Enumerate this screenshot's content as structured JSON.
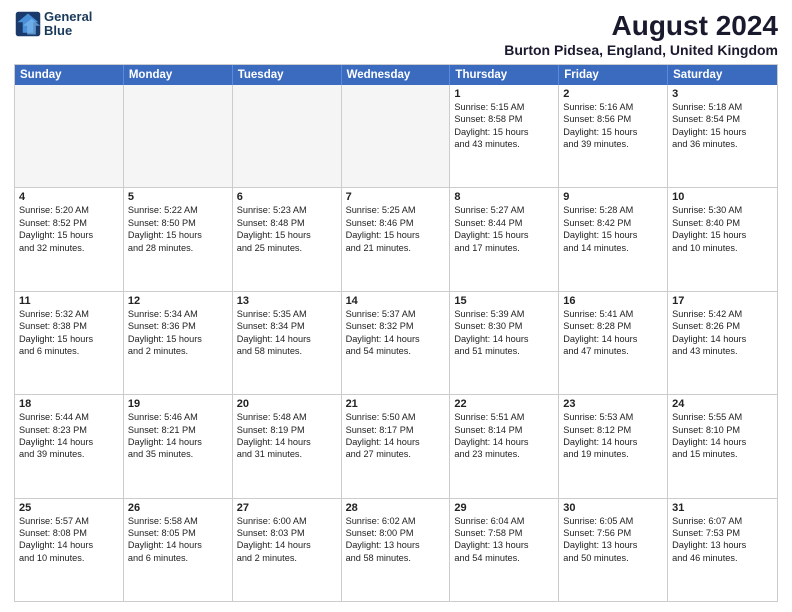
{
  "header": {
    "logo_line1": "General",
    "logo_line2": "Blue",
    "main_title": "August 2024",
    "subtitle": "Burton Pidsea, England, United Kingdom"
  },
  "calendar": {
    "headers": [
      "Sunday",
      "Monday",
      "Tuesday",
      "Wednesday",
      "Thursday",
      "Friday",
      "Saturday"
    ],
    "weeks": [
      [
        {
          "day": "",
          "info": ""
        },
        {
          "day": "",
          "info": ""
        },
        {
          "day": "",
          "info": ""
        },
        {
          "day": "",
          "info": ""
        },
        {
          "day": "1",
          "info": "Sunrise: 5:15 AM\nSunset: 8:58 PM\nDaylight: 15 hours\nand 43 minutes."
        },
        {
          "day": "2",
          "info": "Sunrise: 5:16 AM\nSunset: 8:56 PM\nDaylight: 15 hours\nand 39 minutes."
        },
        {
          "day": "3",
          "info": "Sunrise: 5:18 AM\nSunset: 8:54 PM\nDaylight: 15 hours\nand 36 minutes."
        }
      ],
      [
        {
          "day": "4",
          "info": "Sunrise: 5:20 AM\nSunset: 8:52 PM\nDaylight: 15 hours\nand 32 minutes."
        },
        {
          "day": "5",
          "info": "Sunrise: 5:22 AM\nSunset: 8:50 PM\nDaylight: 15 hours\nand 28 minutes."
        },
        {
          "day": "6",
          "info": "Sunrise: 5:23 AM\nSunset: 8:48 PM\nDaylight: 15 hours\nand 25 minutes."
        },
        {
          "day": "7",
          "info": "Sunrise: 5:25 AM\nSunset: 8:46 PM\nDaylight: 15 hours\nand 21 minutes."
        },
        {
          "day": "8",
          "info": "Sunrise: 5:27 AM\nSunset: 8:44 PM\nDaylight: 15 hours\nand 17 minutes."
        },
        {
          "day": "9",
          "info": "Sunrise: 5:28 AM\nSunset: 8:42 PM\nDaylight: 15 hours\nand 14 minutes."
        },
        {
          "day": "10",
          "info": "Sunrise: 5:30 AM\nSunset: 8:40 PM\nDaylight: 15 hours\nand 10 minutes."
        }
      ],
      [
        {
          "day": "11",
          "info": "Sunrise: 5:32 AM\nSunset: 8:38 PM\nDaylight: 15 hours\nand 6 minutes."
        },
        {
          "day": "12",
          "info": "Sunrise: 5:34 AM\nSunset: 8:36 PM\nDaylight: 15 hours\nand 2 minutes."
        },
        {
          "day": "13",
          "info": "Sunrise: 5:35 AM\nSunset: 8:34 PM\nDaylight: 14 hours\nand 58 minutes."
        },
        {
          "day": "14",
          "info": "Sunrise: 5:37 AM\nSunset: 8:32 PM\nDaylight: 14 hours\nand 54 minutes."
        },
        {
          "day": "15",
          "info": "Sunrise: 5:39 AM\nSunset: 8:30 PM\nDaylight: 14 hours\nand 51 minutes."
        },
        {
          "day": "16",
          "info": "Sunrise: 5:41 AM\nSunset: 8:28 PM\nDaylight: 14 hours\nand 47 minutes."
        },
        {
          "day": "17",
          "info": "Sunrise: 5:42 AM\nSunset: 8:26 PM\nDaylight: 14 hours\nand 43 minutes."
        }
      ],
      [
        {
          "day": "18",
          "info": "Sunrise: 5:44 AM\nSunset: 8:23 PM\nDaylight: 14 hours\nand 39 minutes."
        },
        {
          "day": "19",
          "info": "Sunrise: 5:46 AM\nSunset: 8:21 PM\nDaylight: 14 hours\nand 35 minutes."
        },
        {
          "day": "20",
          "info": "Sunrise: 5:48 AM\nSunset: 8:19 PM\nDaylight: 14 hours\nand 31 minutes."
        },
        {
          "day": "21",
          "info": "Sunrise: 5:50 AM\nSunset: 8:17 PM\nDaylight: 14 hours\nand 27 minutes."
        },
        {
          "day": "22",
          "info": "Sunrise: 5:51 AM\nSunset: 8:14 PM\nDaylight: 14 hours\nand 23 minutes."
        },
        {
          "day": "23",
          "info": "Sunrise: 5:53 AM\nSunset: 8:12 PM\nDaylight: 14 hours\nand 19 minutes."
        },
        {
          "day": "24",
          "info": "Sunrise: 5:55 AM\nSunset: 8:10 PM\nDaylight: 14 hours\nand 15 minutes."
        }
      ],
      [
        {
          "day": "25",
          "info": "Sunrise: 5:57 AM\nSunset: 8:08 PM\nDaylight: 14 hours\nand 10 minutes."
        },
        {
          "day": "26",
          "info": "Sunrise: 5:58 AM\nSunset: 8:05 PM\nDaylight: 14 hours\nand 6 minutes."
        },
        {
          "day": "27",
          "info": "Sunrise: 6:00 AM\nSunset: 8:03 PM\nDaylight: 14 hours\nand 2 minutes."
        },
        {
          "day": "28",
          "info": "Sunrise: 6:02 AM\nSunset: 8:00 PM\nDaylight: 13 hours\nand 58 minutes."
        },
        {
          "day": "29",
          "info": "Sunrise: 6:04 AM\nSunset: 7:58 PM\nDaylight: 13 hours\nand 54 minutes."
        },
        {
          "day": "30",
          "info": "Sunrise: 6:05 AM\nSunset: 7:56 PM\nDaylight: 13 hours\nand 50 minutes."
        },
        {
          "day": "31",
          "info": "Sunrise: 6:07 AM\nSunset: 7:53 PM\nDaylight: 13 hours\nand 46 minutes."
        }
      ]
    ]
  }
}
